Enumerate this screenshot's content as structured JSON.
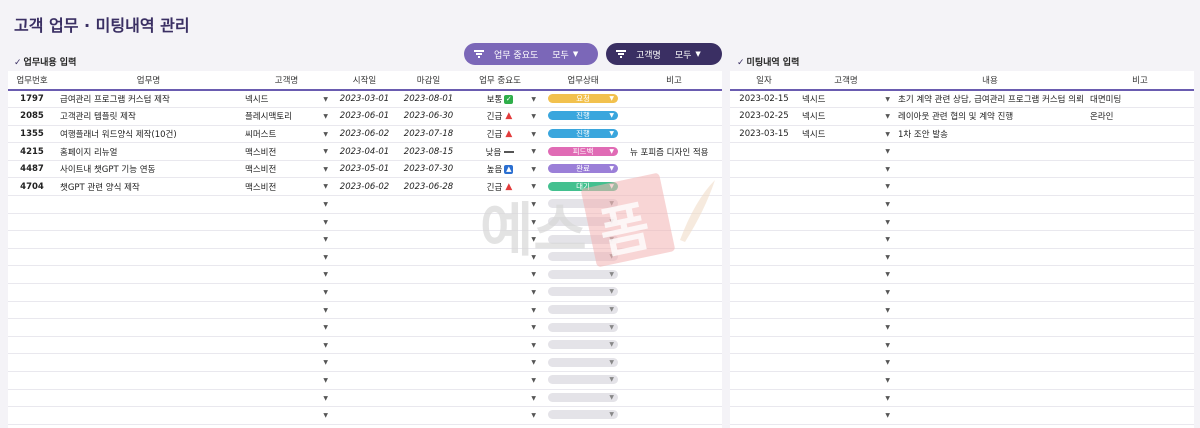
{
  "page_title": "고객 업무 · 미팅내역 관리",
  "left_section_label": "업무내용 입력",
  "right_section_label": "미팅내역 입력",
  "filters": [
    {
      "label": "업무 중요도",
      "value": "모두"
    },
    {
      "label": "고객명",
      "value": "모두"
    }
  ],
  "colors": {
    "accent": "#6a5cb0",
    "filter1": "#7b67b8",
    "filter2": "#3a2f63"
  },
  "tasks": {
    "headers": [
      "업무번호",
      "업무명",
      "고객명",
      "시작일",
      "마감일",
      "업무 중요도",
      "업무상태",
      "비고"
    ],
    "rows": [
      {
        "no": "1797",
        "name": "급여관리 프로그램 커스텀 제작",
        "cust": "넥시드",
        "start": "2023-03-01",
        "end": "2023-08-01",
        "imp": "보통",
        "imp_icon": "check",
        "status": "요청",
        "status_color": "#f2c14e",
        "note": ""
      },
      {
        "no": "2085",
        "name": "고객관리 템플릿 제작",
        "cust": "플레시맥토리",
        "start": "2023-06-01",
        "end": "2023-06-30",
        "imp": "긴급",
        "imp_icon": "alarm",
        "status": "진행",
        "status_color": "#3aa6dd",
        "note": ""
      },
      {
        "no": "1355",
        "name": "여행플래너 워드양식 제작(10건)",
        "cust": "씨머스트",
        "start": "2023-06-02",
        "end": "2023-07-18",
        "imp": "긴급",
        "imp_icon": "alarm",
        "status": "진행",
        "status_color": "#3aa6dd",
        "note": ""
      },
      {
        "no": "4215",
        "name": "홈페이지 리뉴얼",
        "cust": "맥스비전",
        "start": "2023-04-01",
        "end": "2023-08-15",
        "imp": "낮음",
        "imp_icon": "bar",
        "status": "피드백",
        "status_color": "#e06bb5",
        "note": "뉴 포피즘 디자인 적용"
      },
      {
        "no": "4487",
        "name": "사이트내 챗GPT 기능 연동",
        "cust": "맥스비전",
        "start": "2023-05-01",
        "end": "2023-07-30",
        "imp": "높음",
        "imp_icon": "up",
        "status": "완료",
        "status_color": "#9b7fd8",
        "note": ""
      },
      {
        "no": "4704",
        "name": "챗GPT 관련 양식 제작",
        "cust": "맥스비전",
        "start": "2023-06-02",
        "end": "2023-06-28",
        "imp": "긴급",
        "imp_icon": "alarm",
        "status": "대기",
        "status_color": "#43c08f",
        "note": ""
      }
    ],
    "empty_rows": 14
  },
  "meetings": {
    "headers": [
      "일자",
      "고객명",
      "내용",
      "비고"
    ],
    "rows": [
      {
        "date": "2023-02-15",
        "cust": "넥시드",
        "content": "초기 계약 관련 상담, 급여관리 프로그램 커스텀 의뢰",
        "note": "대면미팅"
      },
      {
        "date": "2023-02-25",
        "cust": "넥시드",
        "content": "레이아웃 관련 협의 및 계약 진행",
        "note": "온라인"
      },
      {
        "date": "2023-03-15",
        "cust": "넥시드",
        "content": "1차 조안 발송",
        "note": ""
      }
    ],
    "empty_rows": 17
  },
  "watermark": {
    "text_left": "예스",
    "text_right": "폼"
  }
}
